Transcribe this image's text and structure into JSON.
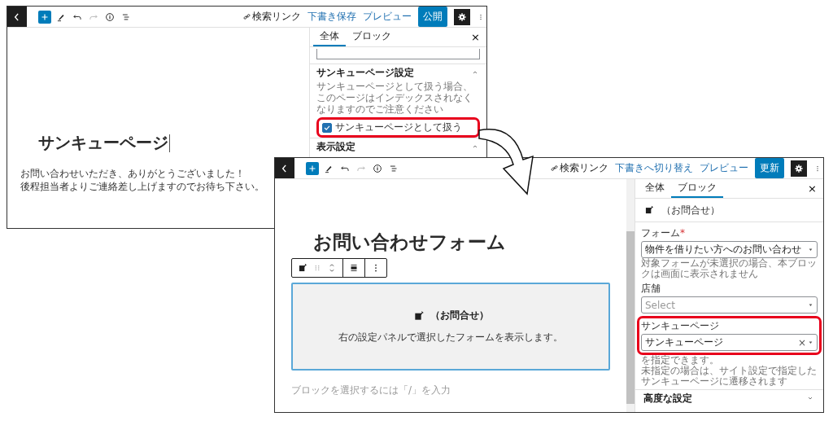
{
  "editor_back": {
    "toolbar": {
      "search_link": "検索リンク",
      "actions": [
        {
          "label": "下書き保存",
          "kind": "link"
        },
        {
          "label": "プレビュー",
          "kind": "link"
        },
        {
          "label": "公開",
          "kind": "primary"
        }
      ]
    },
    "canvas": {
      "title": "サンキューページ",
      "cursor": true,
      "paragraphs": [
        "お問い合わせいただき、ありがとうございました！",
        "後程担当者よりご連絡差し上げますのでお待ち下さい。"
      ]
    },
    "sidebar": {
      "tabs": [
        {
          "label": "全体",
          "selected": true
        },
        {
          "label": "ブロック",
          "selected": false
        }
      ],
      "close": "×",
      "panels": [
        {
          "kind": "textarea"
        },
        {
          "kind": "section",
          "title": "サンキューページ設定",
          "expanded": true,
          "help": [
            "サンキューページとして扱う場合、このページはインデックスされなくなりますのでご注意ください"
          ],
          "checkbox": {
            "label": "サンキューページとして扱う",
            "checked": true,
            "highlighted": true
          }
        },
        {
          "kind": "section",
          "title": "表示設定",
          "expanded": true
        }
      ]
    }
  },
  "editor_front": {
    "toolbar": {
      "search_link": "検索リンク",
      "actions": [
        {
          "label": "下書きへ切り替え",
          "kind": "link"
        },
        {
          "label": "プレビュー",
          "kind": "link"
        },
        {
          "label": "更新",
          "kind": "primary"
        }
      ]
    },
    "canvas": {
      "title": "お問い合わせフォーム",
      "form_block": {
        "name": "（お問合せ）",
        "description": "右の設定パネルで選択したフォームを表示します。",
        "selected": true
      },
      "appender_placeholder": "ブロックを選択するには「/」を入力"
    },
    "sidebar": {
      "tabs": [
        {
          "label": "全体",
          "selected": false
        },
        {
          "label": "ブロック",
          "selected": true
        }
      ],
      "close": "×",
      "block_card": {
        "name": "（お問合せ）"
      },
      "fields": [
        {
          "label": "フォーム",
          "required_mark": "*",
          "value": "物件を借りたい方へのお問い合わせ",
          "help": [
            "対象フォームが未選択の場合、本ブロックは画面に表示されません"
          ]
        },
        {
          "label": "店舗",
          "placeholder": "Select"
        },
        {
          "label": "サンキューページ",
          "value": "サンキューページ",
          "clear": "×",
          "highlighted": true,
          "help": [
            "を指定できます。",
            "未指定の場合は、サイト設定で指定したサンキューページに遷移されます"
          ]
        }
      ],
      "panels": [
        {
          "kind": "section",
          "title": "高度な設定",
          "expanded": false
        }
      ]
    }
  }
}
